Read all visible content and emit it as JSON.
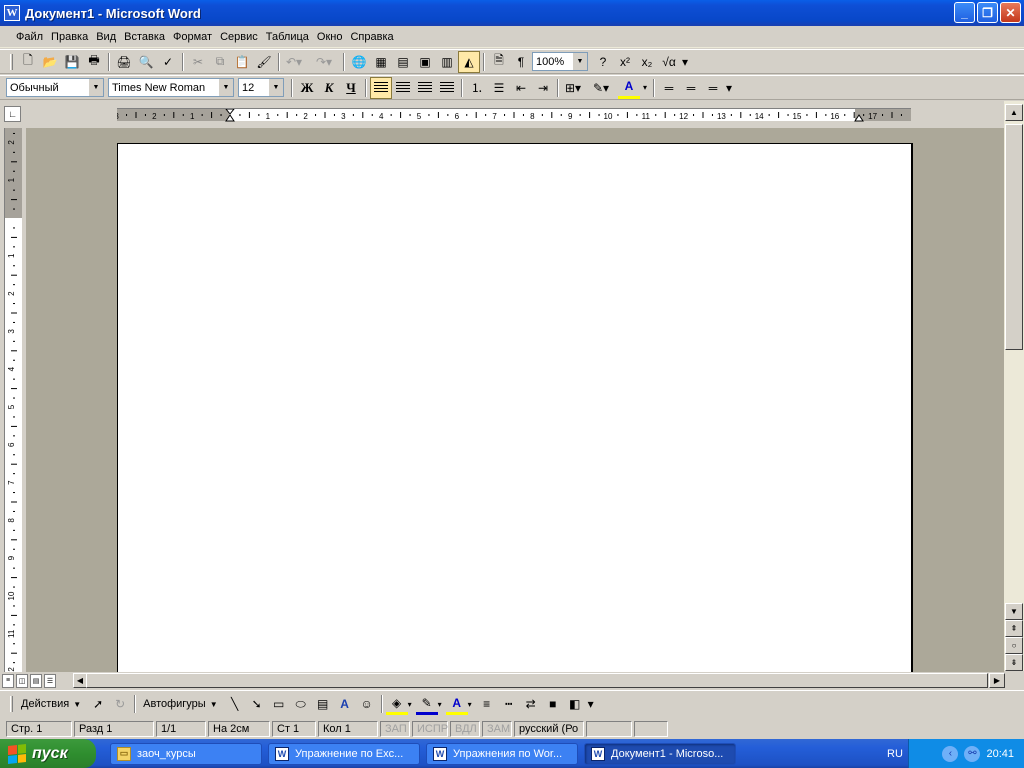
{
  "window": {
    "title": "Документ1 - Microsoft Word",
    "icon": "word-icon"
  },
  "menu": [
    "Файл",
    "Правка",
    "Вид",
    "Вставка",
    "Формат",
    "Сервис",
    "Таблица",
    "Окно",
    "Справка"
  ],
  "standard_toolbar": {
    "zoom": "100%"
  },
  "format_toolbar": {
    "style": "Обычный",
    "font": "Times New Roman",
    "size": "12",
    "bold": "Ж",
    "italic": "К",
    "underline": "Ч"
  },
  "ruler": {
    "h_labels": [
      "3",
      "2",
      "1",
      "1",
      "2",
      "3",
      "4",
      "5",
      "6",
      "7",
      "8",
      "9",
      "10",
      "11",
      "12",
      "13",
      "14",
      "15",
      "16",
      "17"
    ],
    "v_labels": [
      "2",
      "1",
      "1",
      "2",
      "3",
      "4",
      "5",
      "6",
      "7",
      "8",
      "9",
      "10",
      "11",
      "12"
    ]
  },
  "drawing_toolbar": {
    "actions": "Действия",
    "autoshapes": "Автофигуры"
  },
  "status": {
    "page": "Стр.  1",
    "section": "Разд  1",
    "pages": "1/1",
    "at": "На  2см",
    "line": "Ст  1",
    "col": "Кол  1",
    "rec": "ЗАП",
    "trk": "ИСПР",
    "ext": "ВДЛ",
    "ovr": "ЗАМ",
    "lang": "русский (Ро"
  },
  "taskbar": {
    "start": "пуск",
    "tasks": [
      {
        "label": "заоч_курсы",
        "icon": "folder-icon"
      },
      {
        "label": "Упражнение по  Exc...",
        "icon": "word-icon"
      },
      {
        "label": "Упражнения по Wor...",
        "icon": "word-icon"
      },
      {
        "label": "Документ1 - Microso...",
        "icon": "word-icon",
        "active": true
      }
    ],
    "lang": "RU",
    "clock": "20:41"
  },
  "colors": {
    "titlebar": "#0a5ee8",
    "workspace": "#aca899",
    "taskbar": "#245ed8",
    "start": "#2f8e2f",
    "tray": "#0f8ce6"
  }
}
